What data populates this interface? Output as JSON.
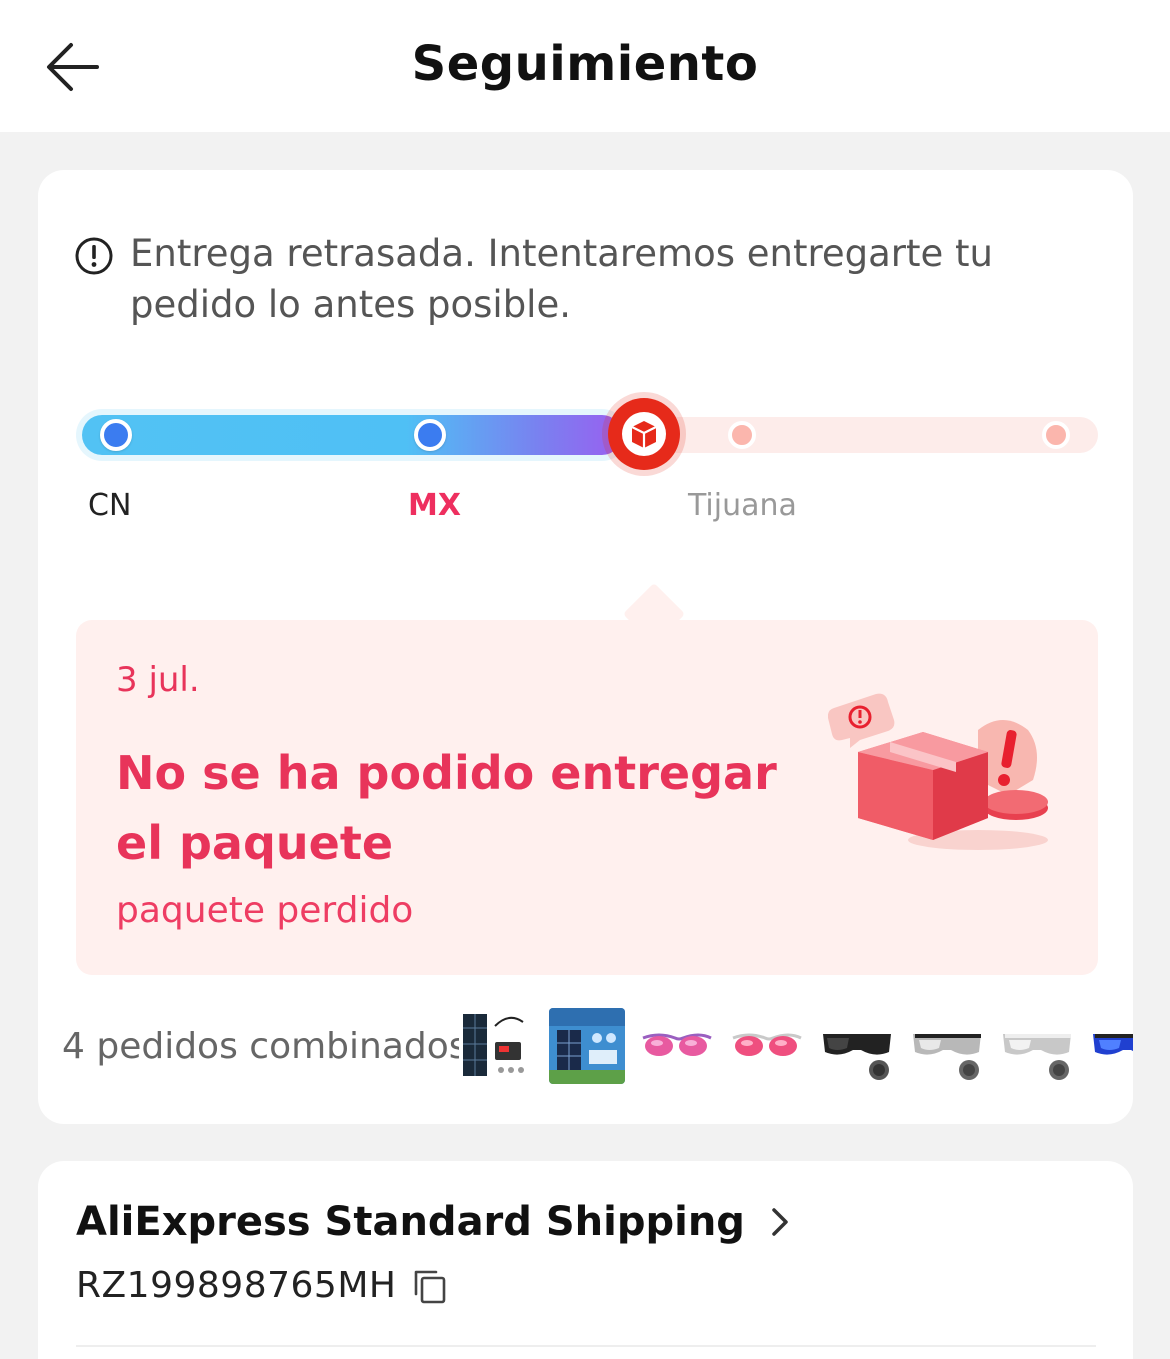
{
  "header": {
    "title": "Seguimiento",
    "back_icon": "arrow-left-icon"
  },
  "status_notice": {
    "icon": "alert-circle-icon",
    "text": "Entrega retrasada. Intentaremos entregarte tu pedido lo antes posible."
  },
  "progress": {
    "stops": [
      {
        "label": "CN",
        "state": "done"
      },
      {
        "label": "MX",
        "state": "done"
      },
      {
        "label": "",
        "state": "current",
        "icon": "package-icon"
      },
      {
        "label": "Tijuana",
        "state": "pending"
      },
      {
        "label": "",
        "state": "pending"
      }
    ],
    "colors": {
      "done": "#52c2f4",
      "current": "#e62a1a",
      "pending": "#fbb6ad",
      "highlight": "#ee2f5f"
    }
  },
  "status_card": {
    "date": "3 jul.",
    "title": "No se ha podido entregar el paquete",
    "subtitle": "paquete perdido",
    "illustration": "lost-package-illustration",
    "accent": "#e8345a"
  },
  "orders": {
    "label": "4 pedidos combinados",
    "thumbnails": [
      "solar-kit-thumbnail",
      "solar-panel-box-thumbnail",
      "pink-sunglasses-thumbnail",
      "pink-sunglasses-thumbnail",
      "black-sport-glasses-thumbnail",
      "silver-sport-glasses-thumbnail",
      "silver-sport-glasses-thumbnail",
      "blue-sport-glasses-thumbnail"
    ]
  },
  "shipping": {
    "carrier": "AliExpress Standard Shipping",
    "tracking_number": "RZ199898765MH",
    "chevron_icon": "chevron-right-icon",
    "copy_icon": "copy-icon"
  }
}
